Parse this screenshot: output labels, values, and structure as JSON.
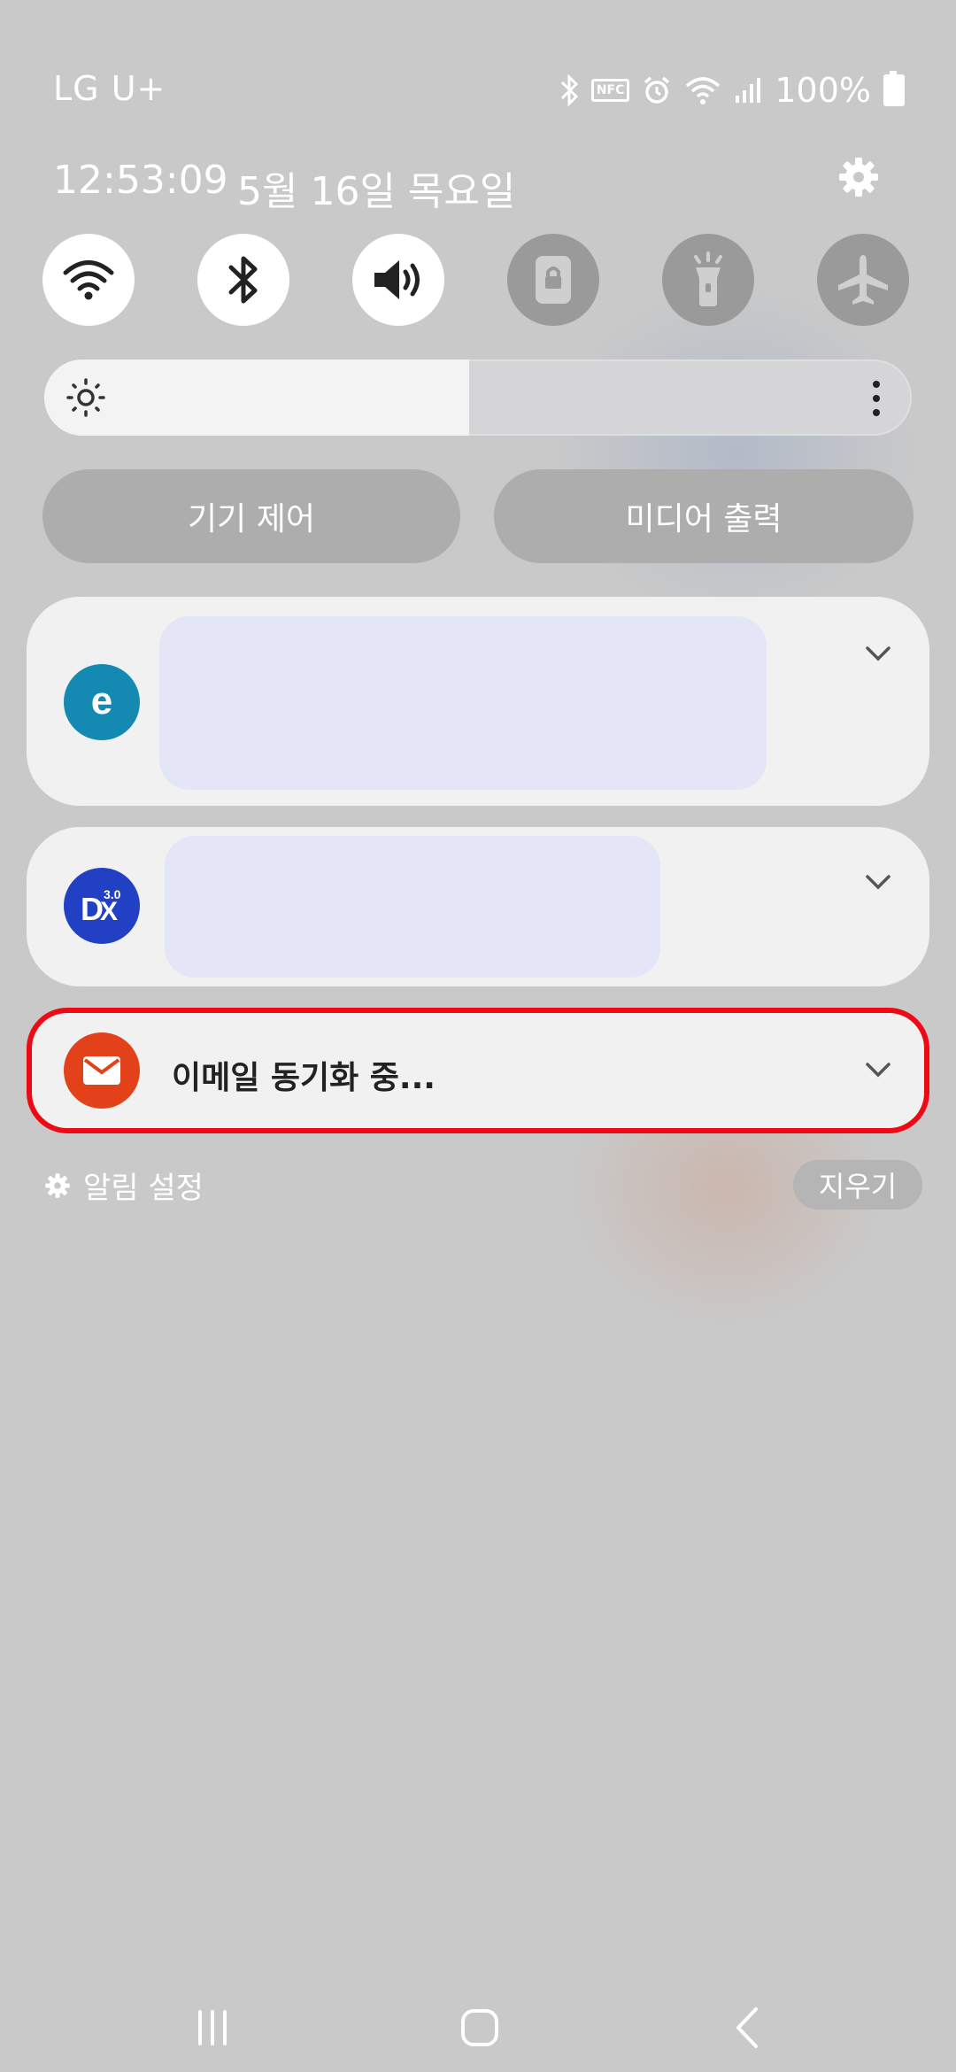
{
  "status_bar": {
    "carrier": "LG U+",
    "time": "12:53:09",
    "date": "5월 16일 목요일",
    "battery": "100%",
    "nfc": "NFC",
    "icons": [
      "bluetooth-icon",
      "nfc-icon",
      "alarm-icon",
      "wifi-icon",
      "signal-icon",
      "battery-icon"
    ]
  },
  "quick_settings": {
    "toggles": [
      {
        "name": "Wi-Fi",
        "icon": "wifi-icon",
        "state": "on"
      },
      {
        "name": "Bluetooth",
        "icon": "bluetooth-icon",
        "state": "on"
      },
      {
        "name": "Sound",
        "icon": "speaker-icon",
        "state": "on"
      },
      {
        "name": "Screen lock",
        "icon": "lock-icon",
        "state": "off"
      },
      {
        "name": "Flashlight",
        "icon": "flashlight-icon",
        "state": "off"
      },
      {
        "name": "Airplane mode",
        "icon": "airplane-icon",
        "state": "off"
      }
    ],
    "brightness_level": 0.49,
    "device_control_label": "기기 제어",
    "media_output_label": "미디어 출력"
  },
  "notifications": [
    {
      "app": "e",
      "icon_color": "#1489b2"
    },
    {
      "app": "DX 3.0",
      "icon_color": "#2140c4"
    },
    {
      "app": "email",
      "icon_color": "#e2411a",
      "title": "이메일 동기화 중..."
    }
  ],
  "footer": {
    "notification_settings_label": "알림 설정",
    "clear_label": "지우기"
  },
  "colors": {
    "highlight": "#ee0a14",
    "background": "#c9c9c9"
  }
}
